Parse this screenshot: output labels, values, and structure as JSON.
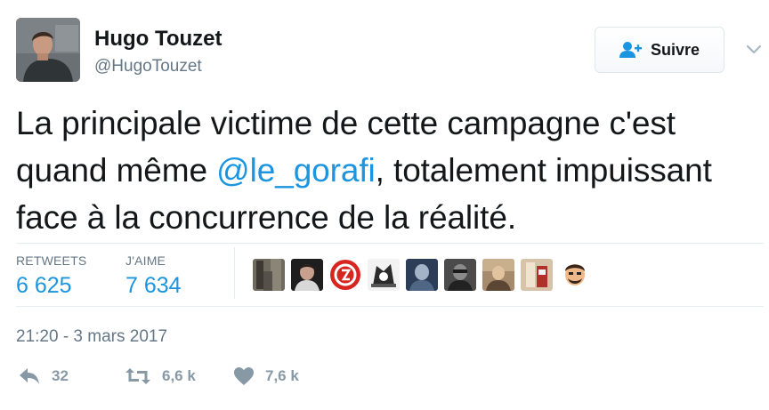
{
  "author": {
    "name": "Hugo Touzet",
    "handle": "@HugoTouzet"
  },
  "follow_button": {
    "label": "Suivre",
    "icon": "add-user-icon"
  },
  "tweet": {
    "text_before": "La principale victime de cette campagne c'est quand même ",
    "mention": "@le_gorafi",
    "text_after": ", totalement impuissant face à la concurrence de la réalité."
  },
  "stats": {
    "retweets_label": "RETWEETS",
    "retweets_value": "6 625",
    "likes_label": "J'AIME",
    "likes_value": "7 634"
  },
  "liker_avatars_count_shown": 9,
  "timestamp": "21:20 - 3 mars 2017",
  "actions": {
    "reply_count": "32",
    "retweet_count": "6,6 k",
    "like_count": "7,6 k"
  },
  "colors": {
    "accent": "#1b95e0",
    "muted": "#657786",
    "icon_muted": "#8899a6",
    "divider": "#e6ecf0"
  }
}
